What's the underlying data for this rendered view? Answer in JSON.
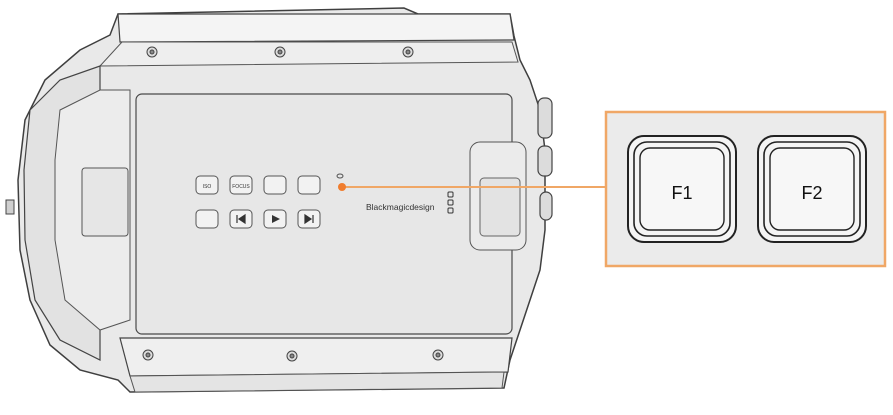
{
  "brand": {
    "logo_text": "Blackmagicdesign"
  },
  "camera": {
    "buttons_row1": [
      "ISO",
      "FOCUS",
      "",
      ""
    ],
    "buttons_row2": [
      "",
      "",
      "",
      ""
    ],
    "icons_row2": [
      "display-icon",
      "skip-back-icon",
      "play-icon",
      "skip-forward-icon"
    ]
  },
  "callout": {
    "buttons": [
      {
        "label": "F1"
      },
      {
        "label": "F2"
      }
    ],
    "accent_color": "#f0a766"
  },
  "colors": {
    "body_light": "#eeeeee",
    "body_mid": "#d9d9d9",
    "outline": "#3a3a3a",
    "accent": "#f0a766",
    "accent_dot": "#f07d2e"
  }
}
